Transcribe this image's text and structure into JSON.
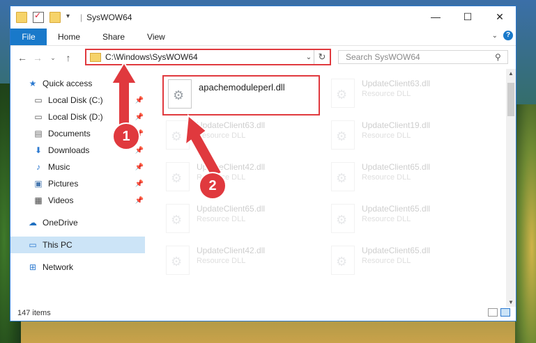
{
  "window": {
    "title": "SysWOW64",
    "controls": {
      "minimize": "—",
      "maximize": "☐",
      "close": "✕"
    }
  },
  "ribbon": {
    "tabs": [
      "File",
      "Home",
      "Share",
      "View"
    ]
  },
  "address_bar": {
    "path": "C:\\Windows\\SysWOW64",
    "search_placeholder": "Search SysWOW64"
  },
  "sidebar": {
    "items": [
      {
        "label": "Quick access",
        "icon": "star-icon",
        "pinned": false
      },
      {
        "label": "Local Disk (C:)",
        "icon": "drive-icon",
        "pinned": true
      },
      {
        "label": "Local Disk (D:)",
        "icon": "drive-icon",
        "pinned": true
      },
      {
        "label": "Documents",
        "icon": "documents-icon",
        "pinned": true
      },
      {
        "label": "Downloads",
        "icon": "download-icon",
        "pinned": true
      },
      {
        "label": "Music",
        "icon": "music-icon",
        "pinned": true
      },
      {
        "label": "Pictures",
        "icon": "pictures-icon",
        "pinned": true
      },
      {
        "label": "Videos",
        "icon": "videos-icon",
        "pinned": true
      },
      {
        "label": "OneDrive",
        "icon": "cloud-icon",
        "pinned": false
      },
      {
        "label": "This PC",
        "icon": "computer-icon",
        "pinned": false,
        "selected": true
      },
      {
        "label": "Network",
        "icon": "network-icon",
        "pinned": false
      }
    ]
  },
  "files": {
    "highlighted": {
      "name": "apachemoduleperl.dll"
    },
    "items": [
      {
        "name": "UpdateClient63.dll",
        "type": "Resource DLL"
      },
      {
        "name": "UpdateClient63.dll",
        "type": "Resource DLL"
      },
      {
        "name": "UpdateClient19.dll",
        "type": "Resource DLL"
      },
      {
        "name": "UpdateClient42.dll",
        "type": "Resource DLL"
      },
      {
        "name": "UpdateClient65.dll",
        "type": "Resource DLL"
      },
      {
        "name": "UpdateClient65.dll",
        "type": "Resource DLL"
      },
      {
        "name": "UpdateClient65.dll",
        "type": "Resource DLL"
      },
      {
        "name": "UpdateClient42.dll",
        "type": "Resource DLL"
      },
      {
        "name": "UpdateClient65.dll",
        "type": "Resource DLL"
      }
    ]
  },
  "status": {
    "count": "147 items"
  },
  "annotations": {
    "step1": "1",
    "step2": "2"
  },
  "colors": {
    "accent": "#1979ca",
    "highlight": "#e0393e",
    "selected_bg": "#cce4f7"
  }
}
